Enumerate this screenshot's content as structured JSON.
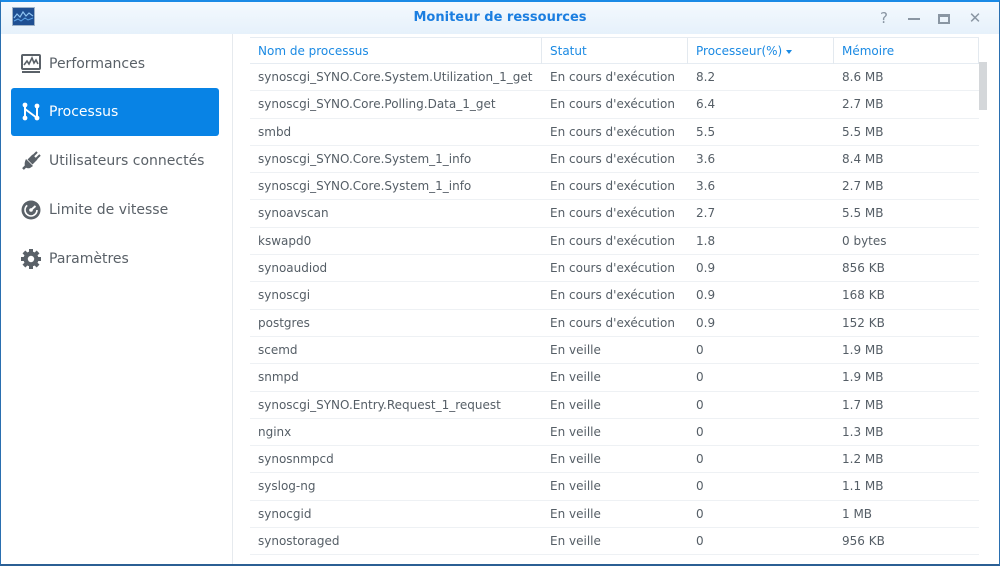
{
  "window": {
    "title": "Moniteur de ressources",
    "controls": {
      "help": "?",
      "minimize": "—",
      "maximize": "□",
      "close": "✕"
    }
  },
  "sidebar": {
    "items": [
      {
        "label": "Performances",
        "icon": "performance-chart-icon",
        "active": false
      },
      {
        "label": "Processus",
        "icon": "process-nodes-icon",
        "active": true
      },
      {
        "label": "Utilisateurs connectés",
        "icon": "plug-icon",
        "active": false
      },
      {
        "label": "Limite de vitesse",
        "icon": "speedometer-icon",
        "active": false
      },
      {
        "label": "Paramètres",
        "icon": "gear-icon",
        "active": false
      }
    ]
  },
  "table": {
    "columns": [
      {
        "label": "Nom de processus",
        "sorted": false
      },
      {
        "label": "Statut",
        "sorted": false
      },
      {
        "label": "Processeur(%)",
        "sorted": true,
        "sort_direction": "desc"
      },
      {
        "label": "Mémoire",
        "sorted": false
      }
    ],
    "rows": [
      {
        "name": "synoscgi_SYNO.Core.System.Utilization_1_get",
        "status": "En cours d'exécution",
        "cpu": "8.2",
        "memory": "8.6 MB"
      },
      {
        "name": "synoscgi_SYNO.Core.Polling.Data_1_get",
        "status": "En cours d'exécution",
        "cpu": "6.4",
        "memory": "2.7 MB"
      },
      {
        "name": "smbd",
        "status": "En cours d'exécution",
        "cpu": "5.5",
        "memory": "5.5 MB"
      },
      {
        "name": "synoscgi_SYNO.Core.System_1_info",
        "status": "En cours d'exécution",
        "cpu": "3.6",
        "memory": "8.4 MB"
      },
      {
        "name": "synoscgi_SYNO.Core.System_1_info",
        "status": "En cours d'exécution",
        "cpu": "3.6",
        "memory": "2.7 MB"
      },
      {
        "name": "synoavscan",
        "status": "En cours d'exécution",
        "cpu": "2.7",
        "memory": "5.5 MB"
      },
      {
        "name": "kswapd0",
        "status": "En cours d'exécution",
        "cpu": "1.8",
        "memory": "0 bytes"
      },
      {
        "name": "synoaudiod",
        "status": "En cours d'exécution",
        "cpu": "0.9",
        "memory": "856 KB"
      },
      {
        "name": "synoscgi",
        "status": "En cours d'exécution",
        "cpu": "0.9",
        "memory": "168 KB"
      },
      {
        "name": "postgres",
        "status": "En cours d'exécution",
        "cpu": "0.9",
        "memory": "152 KB"
      },
      {
        "name": "scemd",
        "status": "En veille",
        "cpu": "0",
        "memory": "1.9 MB"
      },
      {
        "name": "snmpd",
        "status": "En veille",
        "cpu": "0",
        "memory": "1.9 MB"
      },
      {
        "name": "synoscgi_SYNO.Entry.Request_1_request",
        "status": "En veille",
        "cpu": "0",
        "memory": "1.7 MB"
      },
      {
        "name": "nginx",
        "status": "En veille",
        "cpu": "0",
        "memory": "1.3 MB"
      },
      {
        "name": "synosnmpcd",
        "status": "En veille",
        "cpu": "0",
        "memory": "1.2 MB"
      },
      {
        "name": "syslog-ng",
        "status": "En veille",
        "cpu": "0",
        "memory": "1.1 MB"
      },
      {
        "name": "synocgid",
        "status": "En veille",
        "cpu": "0",
        "memory": "1 MB"
      },
      {
        "name": "synostoraged",
        "status": "En veille",
        "cpu": "0",
        "memory": "956 KB"
      }
    ]
  },
  "colors": {
    "accent": "#0883e5",
    "title": "#1b7ee0",
    "header_text": "#1b8ae3",
    "body_text": "#555e66"
  }
}
